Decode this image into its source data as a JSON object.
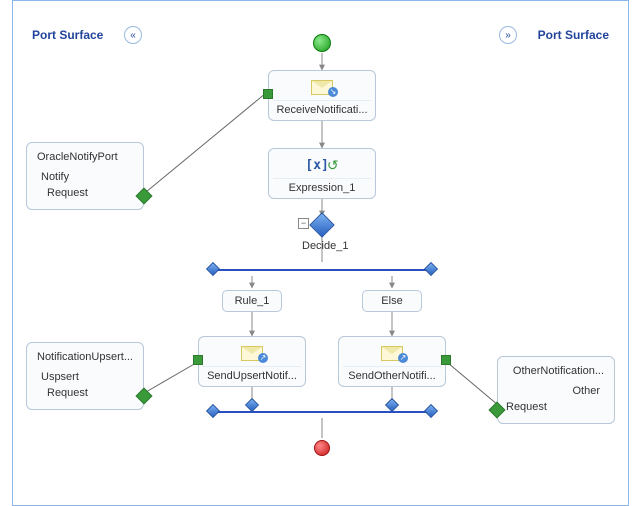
{
  "surfaces": {
    "left_label": "Port Surface",
    "right_label": "Port Surface"
  },
  "ports": {
    "oracle_notify": {
      "title": "OracleNotifyPort",
      "operation": "Notify",
      "request": "Request"
    },
    "notification_upsert": {
      "title": "NotificationUpsert...",
      "operation": "Uspsert",
      "request": "Request"
    },
    "other_notification": {
      "title": "OtherNotification...",
      "operation": "Other",
      "request": "Request"
    }
  },
  "shapes": {
    "receive": "ReceiveNotificati...",
    "expression": "Expression_1",
    "decide": "Decide_1",
    "rule": "Rule_1",
    "else": "Else",
    "send_upsert": "SendUpsertNotif...",
    "send_other": "SendOtherNotifi..."
  },
  "icons": {
    "collapse_left": "«",
    "collapse_right": "»",
    "minus": "−"
  }
}
